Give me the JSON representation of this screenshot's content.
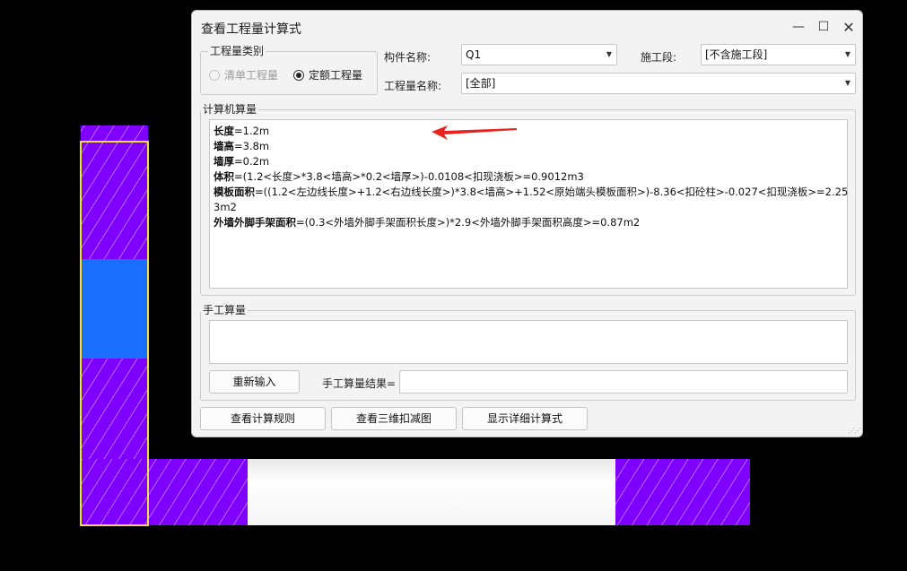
{
  "dialog": {
    "title": "查看工程量计算式",
    "window_buttons": {
      "minimize": "—",
      "maximize": "☐",
      "close": "✕"
    }
  },
  "category": {
    "label": "工程量类别",
    "options": [
      {
        "label": "清单工程量",
        "state": "disabled"
      },
      {
        "label": "定额工程量",
        "state": "checked"
      }
    ]
  },
  "component": {
    "label": "构件名称:",
    "value": "Q1"
  },
  "phase": {
    "label": "施工段:",
    "value": "[不含施工段]"
  },
  "quantity_name": {
    "label": "工程量名称:",
    "value": "[全部]"
  },
  "computer_calc": {
    "label": "计算机算量",
    "lines": [
      {
        "name": "长度",
        "expr": "=1.2m"
      },
      {
        "name": "墙高",
        "expr": "=3.8m"
      },
      {
        "name": "墙厚",
        "expr": "=0.2m"
      },
      {
        "name": "体积",
        "expr": "=(1.2<长度>*3.8<墙高>*0.2<墙厚>)-0.0108<扣现浇板>=0.9012m3"
      },
      {
        "name": "模板面积",
        "expr": "=((1.2<左边线长度>+1.2<右边线长度>)*3.8<墙高>+1.52<原始端头模板面积>)-8.36<扣砼柱>-0.027<扣现浇板>=2.25"
      },
      {
        "name": "",
        "expr": "3m2"
      },
      {
        "name": "外墙外脚手架面积",
        "expr": "=(0.3<外墙外脚手架面积长度>)*2.9<外墙外脚手架面积高度>=0.87m2"
      }
    ]
  },
  "manual_calc": {
    "label": "手工算量",
    "reenter_button": "重新输入",
    "result_label": "手工算量结果=",
    "result_value": ""
  },
  "bottom_buttons": {
    "view_rules": "查看计算规则",
    "view_3d": "查看三维扣减图",
    "show_detail": "显示详细计算式"
  },
  "colors": {
    "wall_hatch": "#8000ff",
    "opening_blue": "#1a6fff",
    "annotation_arrow": "#e8231e"
  }
}
